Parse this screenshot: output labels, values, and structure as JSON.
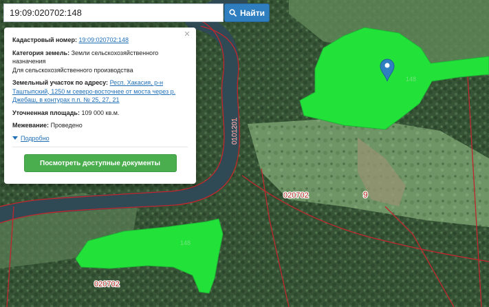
{
  "search": {
    "value": "19:09:020702:148",
    "button_label": "Найти"
  },
  "popup": {
    "cadastral_label": "Кадастровый номер:",
    "cadastral_value": "19:09:020702:148",
    "category_label": "Категория земель:",
    "category_value": "Земли сельскохозяйственного назначения",
    "usage_value": "Для сельскохозяйственного производства",
    "address_label": "Земельный участок по адресу:",
    "address_value": "Респ. Хакасия, р-н Таштыпский, 1250 м северо-восточнее от моста через р. Джебаш, в контурах п.п. № 25, 27, 21",
    "area_label": "Уточненная площадь:",
    "area_value": "109 000 кв.м.",
    "survey_label": "Межевание:",
    "survey_value": "Проведено",
    "more_label": "Подробно",
    "docs_button": "Посмотреть доступные документы",
    "close_symbol": "×"
  },
  "map": {
    "parcel_number_top": "148",
    "parcel_number_bottom": "148",
    "river_label": "0101201",
    "quarter_label_right": "020702",
    "quarter_label_bottom": "020702",
    "block_number": "9",
    "parcel_color": "#22e23a",
    "boundary_color": "#c2262e",
    "marker_icon": "map-pin-icon"
  }
}
